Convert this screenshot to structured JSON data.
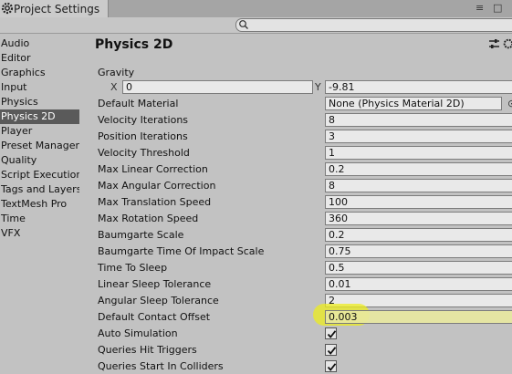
{
  "window": {
    "title": "Project Settings",
    "controls": [
      "≡",
      "□"
    ]
  },
  "search": {
    "placeholder": ""
  },
  "sidebar": {
    "items": [
      {
        "label": "Audio"
      },
      {
        "label": "Editor"
      },
      {
        "label": "Graphics"
      },
      {
        "label": "Input"
      },
      {
        "label": "Physics"
      },
      {
        "label": "Physics 2D",
        "selected": true
      },
      {
        "label": "Player"
      },
      {
        "label": "Preset Manager"
      },
      {
        "label": "Quality"
      },
      {
        "label": "Script Execution Order"
      },
      {
        "label": "Tags and Layers"
      },
      {
        "label": "TextMesh Pro"
      },
      {
        "label": "Time"
      },
      {
        "label": "VFX"
      }
    ]
  },
  "header": {
    "title": "Physics 2D"
  },
  "gravity": {
    "label": "Gravity",
    "x_label": "X",
    "x": "0",
    "y_label": "Y",
    "y": "-9.81"
  },
  "settings": [
    {
      "label": "Default Material",
      "value": "None (Physics Material 2D)"
    },
    {
      "label": "Velocity Iterations",
      "value": "8"
    },
    {
      "label": "Position Iterations",
      "value": "3"
    },
    {
      "label": "Velocity Threshold",
      "value": "1"
    },
    {
      "label": "Max Linear Correction",
      "value": "0.2"
    },
    {
      "label": "Max Angular Correction",
      "value": "8"
    },
    {
      "label": "Max Translation Speed",
      "value": "100"
    },
    {
      "label": "Max Rotation Speed",
      "value": "360"
    },
    {
      "label": "Baumgarte Scale",
      "value": "0.2"
    },
    {
      "label": "Baumgarte Time Of Impact Scale",
      "value": "0.75"
    },
    {
      "label": "Time To Sleep",
      "value": "0.5"
    },
    {
      "label": "Linear Sleep Tolerance",
      "value": "0.01"
    },
    {
      "label": "Angular Sleep Tolerance",
      "value": "2"
    },
    {
      "label": "Default Contact Offset",
      "value": "0.003"
    }
  ],
  "toggles": [
    {
      "label": "Auto Simulation",
      "checked": true
    },
    {
      "label": "Queries Hit Triggers",
      "checked": true
    },
    {
      "label": "Queries Start In Colliders",
      "checked": true
    }
  ],
  "colors": {
    "highlight": "#ecec1e",
    "selected_bg": "#5a5a5a"
  }
}
